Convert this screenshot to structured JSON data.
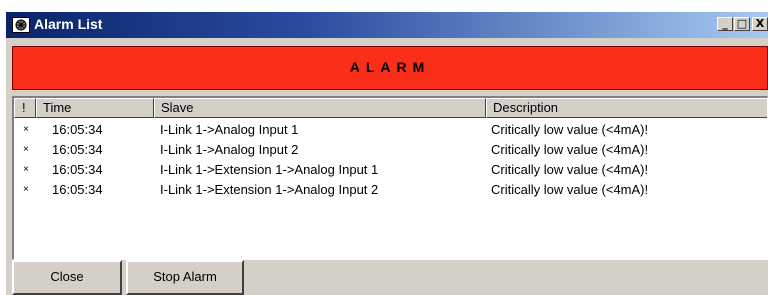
{
  "window": {
    "title": "Alarm List",
    "minimize": "_",
    "maximize": "□",
    "close": "X"
  },
  "banner": {
    "text": "ALARM",
    "color": "#fb2e1a"
  },
  "table": {
    "columns": [
      "!",
      "Time",
      "Slave",
      "Description"
    ],
    "rows": [
      {
        "flag": "×",
        "time": "16:05:34",
        "slave": "I-Link 1->Analog Input 1",
        "description": "Critically low value (<4mA)!"
      },
      {
        "flag": "×",
        "time": "16:05:34",
        "slave": "I-Link 1->Analog Input 2",
        "description": "Critically low value (<4mA)!"
      },
      {
        "flag": "×",
        "time": "16:05:34",
        "slave": "I-Link 1->Extension 1->Analog Input 1",
        "description": "Critically low value (<4mA)!"
      },
      {
        "flag": "×",
        "time": "16:05:34",
        "slave": "I-Link 1->Extension 1->Analog Input 2",
        "description": "Critically low value (<4mA)!"
      }
    ]
  },
  "buttons": {
    "close": "Close",
    "stop_alarm": "Stop Alarm"
  }
}
